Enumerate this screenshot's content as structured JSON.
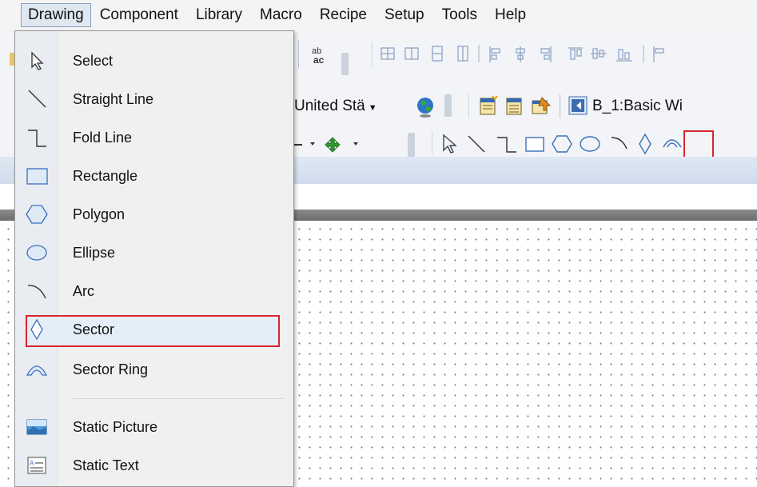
{
  "menubar": {
    "items": [
      "Drawing",
      "Component",
      "Library",
      "Macro",
      "Recipe",
      "Setup",
      "Tools",
      "Help"
    ],
    "active": "Drawing"
  },
  "toolbar": {
    "language_select": "United Stä",
    "window_label": "B_1:Basic Wi"
  },
  "dropdown": {
    "items": [
      {
        "label": "Select",
        "icon": "cursor-icon"
      },
      {
        "label": "Straight Line",
        "icon": "line-icon"
      },
      {
        "label": "Fold Line",
        "icon": "fold-line-icon"
      },
      {
        "label": "Rectangle",
        "icon": "rectangle-icon"
      },
      {
        "label": "Polygon",
        "icon": "polygon-icon"
      },
      {
        "label": "Ellipse",
        "icon": "ellipse-icon"
      },
      {
        "label": "Arc",
        "icon": "arc-icon"
      },
      {
        "label": "Sector",
        "icon": "sector-icon",
        "highlighted": true
      },
      {
        "label": "Sector Ring",
        "icon": "sector-ring-icon"
      },
      {
        "label": "Static Picture",
        "icon": "picture-icon"
      },
      {
        "label": "Static Text",
        "icon": "text-icon"
      }
    ]
  },
  "colors": {
    "highlight_border": "#d9262b",
    "highlight_fill": "#e4eef9"
  }
}
